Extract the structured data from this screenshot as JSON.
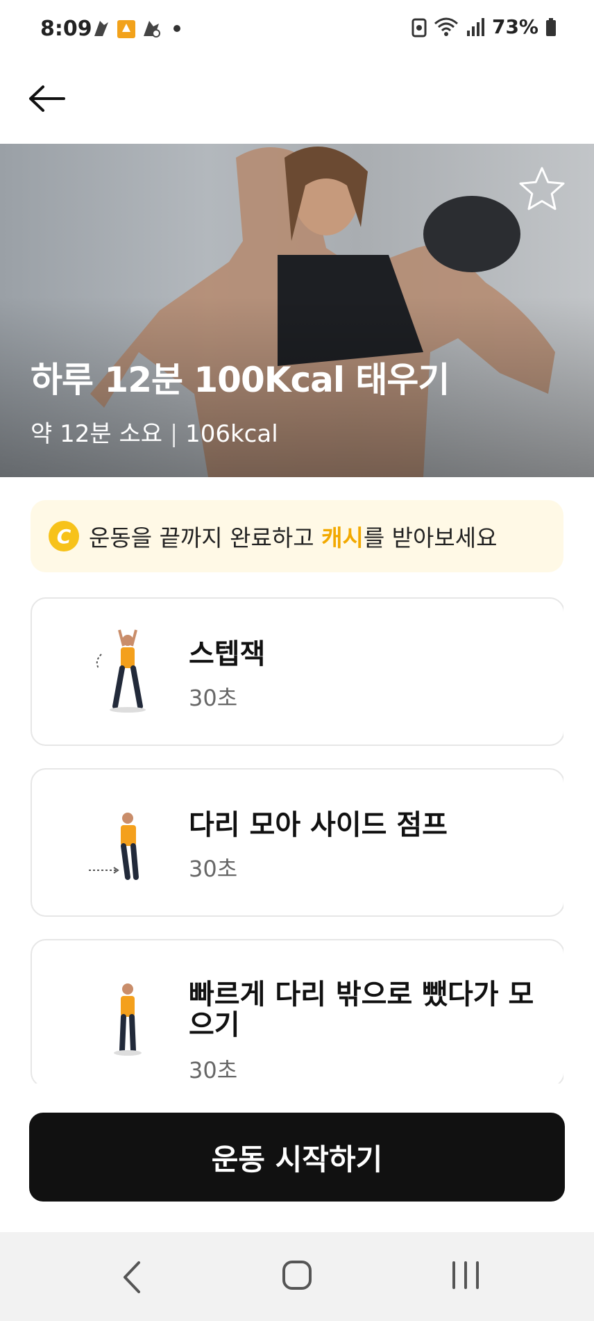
{
  "status_bar": {
    "time": "8:09",
    "battery": "73%"
  },
  "header": {
    "back_icon": "arrow-left-icon"
  },
  "hero": {
    "title": "하루 12분 100Kcal 태우기",
    "duration": "약 12분 소요",
    "separator": "|",
    "calories": "106kcal",
    "favorite_icon": "star-outline-icon"
  },
  "cash_banner": {
    "icon_letter": "C",
    "text_before": "운동을 끝까지 완료하고 ",
    "accent": "캐시",
    "text_after": "를 받아보세요",
    "accent_color": "#f2a900"
  },
  "exercises": [
    {
      "name": "스텝잭",
      "duration": "30초"
    },
    {
      "name": "다리 모아 사이드 점프",
      "duration": "30초"
    },
    {
      "name": "빠르게 다리 밖으로 뺐다가 모으기",
      "duration": "30초"
    }
  ],
  "start_button": {
    "label": "운동 시작하기"
  },
  "nav_bar": {
    "back_icon": "nav-back-icon",
    "home_icon": "nav-home-icon",
    "recent_icon": "nav-recent-apps-icon"
  }
}
